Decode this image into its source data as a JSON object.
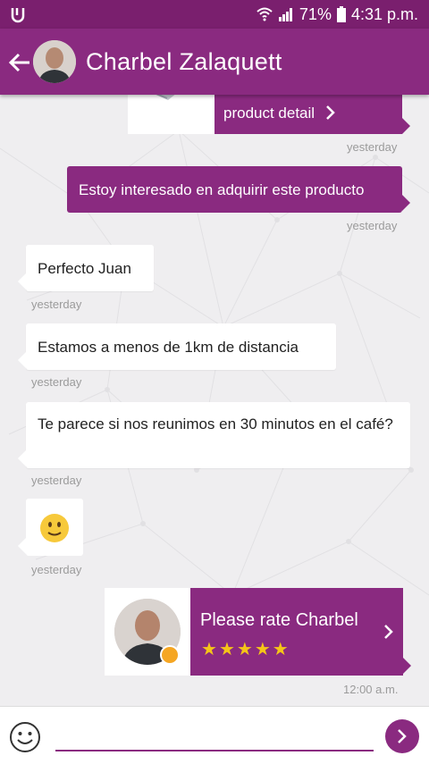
{
  "status_bar": {
    "battery": "71%",
    "time": "4:31 p.m."
  },
  "header": {
    "contact_name": "Charbel Zalaquett"
  },
  "messages": [
    {
      "type": "product",
      "button_label": "product detail",
      "time": "yesterday"
    },
    {
      "type": "outgoing",
      "text": "Estoy interesado en adquirir este producto",
      "time": "yesterday"
    },
    {
      "type": "incoming",
      "text": "Perfecto Juan",
      "time": "yesterday"
    },
    {
      "type": "incoming",
      "text": "Estamos a menos de 1km de distancia",
      "time": "yesterday"
    },
    {
      "type": "incoming",
      "text": "Te parece si nos reunimos en 30 minutos en el café?",
      "time": "yesterday"
    },
    {
      "type": "incoming-emoji",
      "emoji": "slightly-smiling-face",
      "time": "yesterday"
    },
    {
      "type": "rating",
      "text": "Please rate Charbel",
      "stars": 5,
      "time": "12:00 a.m."
    }
  ],
  "input": {
    "placeholder": "",
    "value": ""
  },
  "colors": {
    "primary": "#8a2a80",
    "status_bar": "#7a1f6e",
    "star": "#f5c518",
    "online_dot": "#f5a623"
  }
}
